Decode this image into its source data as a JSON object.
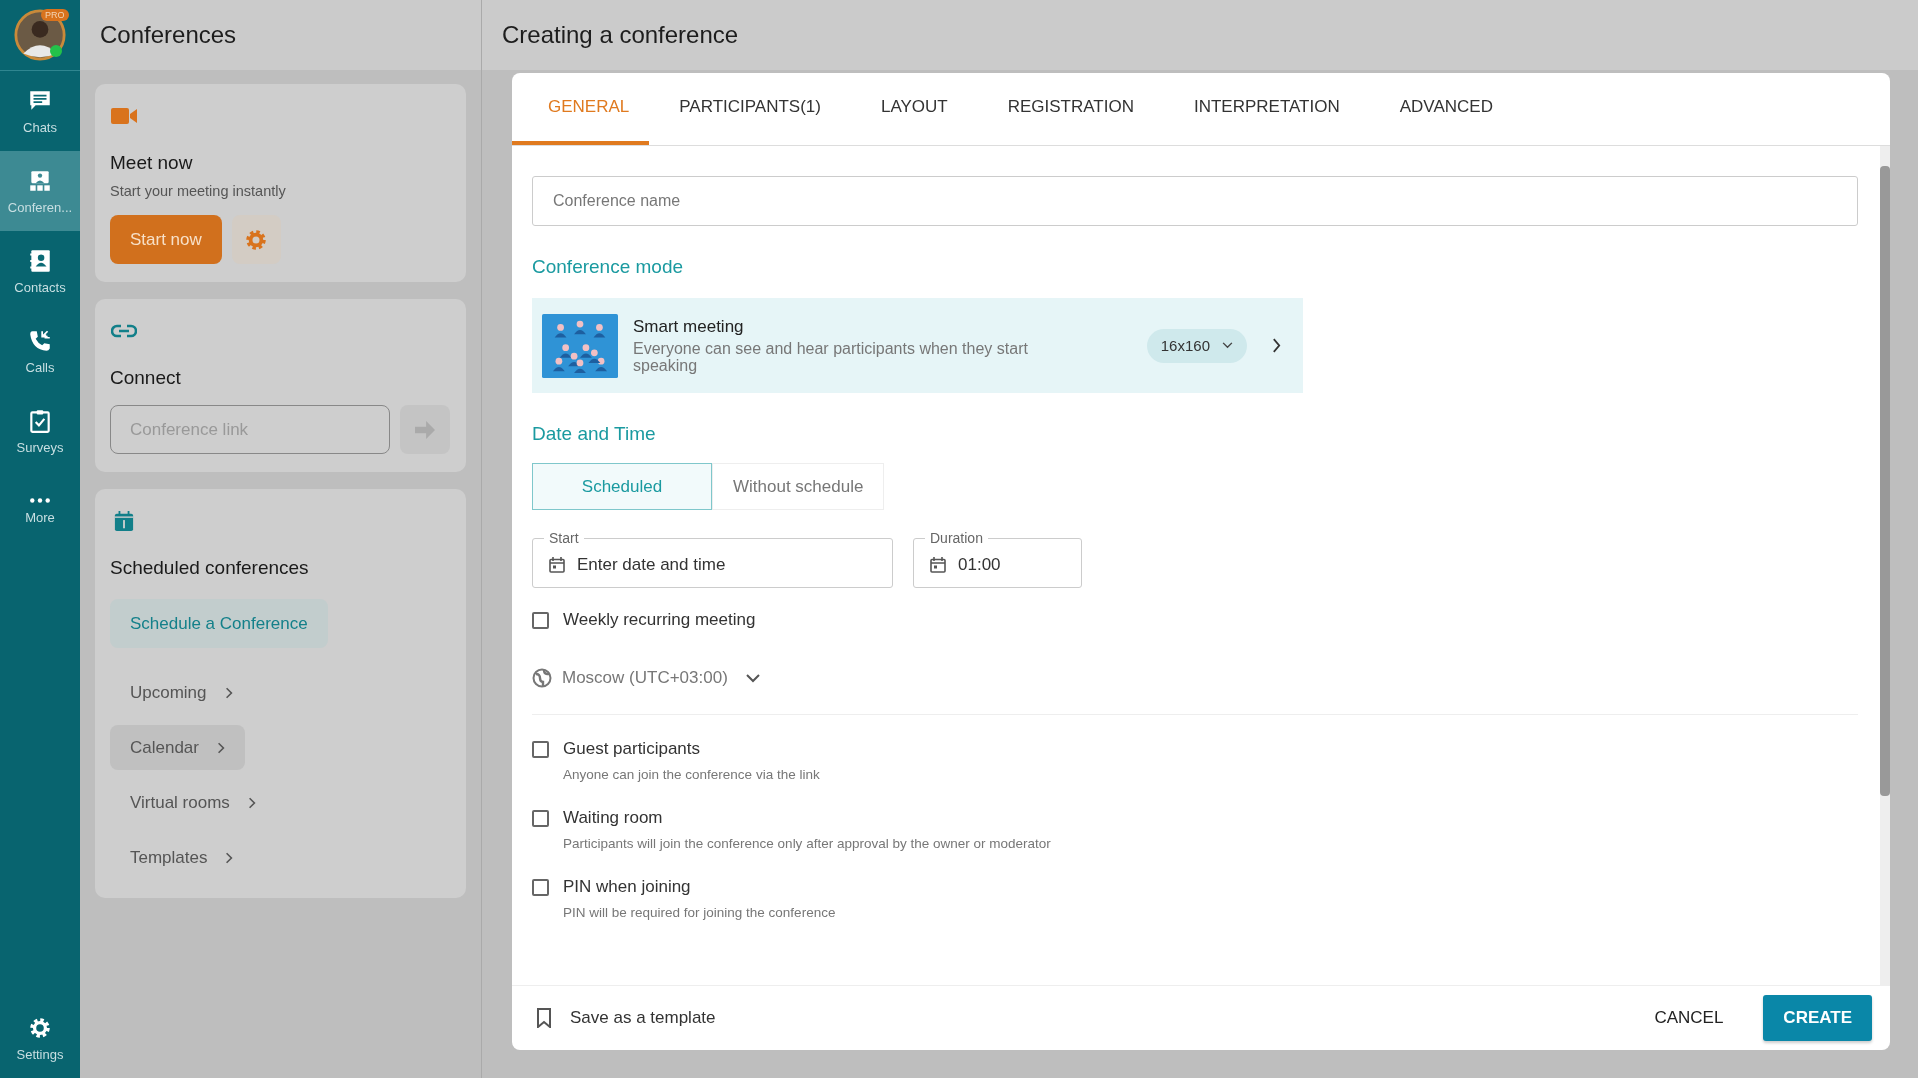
{
  "nav": {
    "avatar": {
      "badge": "PRO",
      "online": true
    },
    "items": [
      {
        "label": "Chats",
        "selected": false
      },
      {
        "label": "Conferen...",
        "selected": true
      },
      {
        "label": "Contacts",
        "selected": false
      },
      {
        "label": "Calls",
        "selected": false
      },
      {
        "label": "Surveys",
        "selected": false
      },
      {
        "label": "More",
        "selected": false
      }
    ],
    "settings": "Settings"
  },
  "panel": {
    "title": "Conferences",
    "meet_now": {
      "title": "Meet now",
      "subtitle": "Start your meeting instantly",
      "button": "Start now"
    },
    "connect": {
      "title": "Connect",
      "placeholder": "Conference link"
    },
    "scheduled": {
      "title": "Scheduled conferences",
      "button": "Schedule a Conference",
      "links": [
        {
          "label": "Upcoming",
          "selected": false
        },
        {
          "label": "Calendar",
          "selected": true
        },
        {
          "label": "Virtual rooms",
          "selected": false
        },
        {
          "label": "Templates",
          "selected": false
        }
      ]
    }
  },
  "dialog": {
    "title": "Creating a conference",
    "tabs": [
      {
        "label": "GENERAL",
        "selected": true
      },
      {
        "label": "PARTICIPANTS(1)",
        "selected": false
      },
      {
        "label": "LAYOUT",
        "selected": false
      },
      {
        "label": "REGISTRATION",
        "selected": false
      },
      {
        "label": "INTERPRETATION",
        "selected": false
      },
      {
        "label": "ADVANCED",
        "selected": false
      }
    ],
    "name_placeholder": "Conference name",
    "mode_heading": "Conference mode",
    "mode": {
      "title": "Smart meeting",
      "description": "Everyone can see and hear participants when they start speaking",
      "size": "16x160"
    },
    "date_heading": "Date and Time",
    "schedule_modes": [
      {
        "label": "Scheduled",
        "selected": true
      },
      {
        "label": "Without schedule",
        "selected": false
      }
    ],
    "start": {
      "label": "Start",
      "placeholder": "Enter date and time"
    },
    "duration": {
      "label": "Duration",
      "value": "01:00"
    },
    "weekly": {
      "label": "Weekly recurring meeting",
      "checked": false
    },
    "timezone": "Moscow (UTC+03:00)",
    "options": [
      {
        "label": "Guest participants",
        "hint": "Anyone can join the conference via the link",
        "checked": false
      },
      {
        "label": "Waiting room",
        "hint": "Participants will join the conference only after approval by the owner or moderator",
        "checked": false
      },
      {
        "label": "PIN when joining",
        "hint": "PIN will be required for joining the conference",
        "checked": false
      }
    ],
    "save_template": "Save as a template",
    "cancel": "CANCEL",
    "create": "CREATE"
  }
}
